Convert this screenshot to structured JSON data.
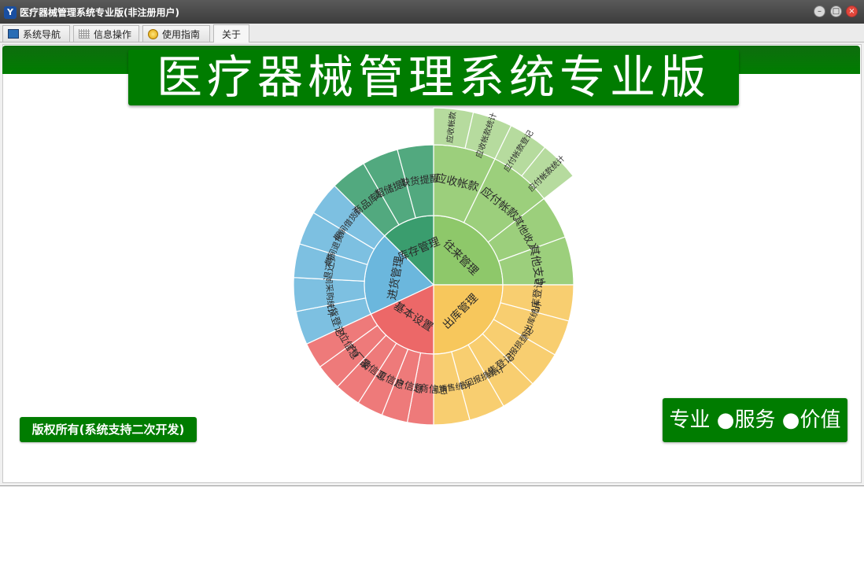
{
  "window": {
    "title": "医疗器械管理系统专业版(非注册用户)"
  },
  "tabs": [
    {
      "label": "系统导航",
      "icon": "monitor-icon"
    },
    {
      "label": "信息操作",
      "icon": "grid-icon"
    },
    {
      "label": "使用指南",
      "icon": "help-icon"
    },
    {
      "label": "关于",
      "icon": ""
    }
  ],
  "banner": {
    "title": "医疗器械管理系统专业版"
  },
  "copyright": "版权所有(系统支持二次开发)",
  "slogan": "专业 ●服务 ●价值",
  "colors": {
    "brand_green": "#007c00",
    "titlebar": "#3c3c3c"
  },
  "sunburst": {
    "groups": [
      {
        "name": "往来管理",
        "color": "#8ec86a",
        "children": [
          {
            "name": "应收帐款",
            "children": [
              "应收帐款",
              "应收帐款统计"
            ]
          },
          {
            "name": "应付帐款",
            "children": [
              "应付帐款登记",
              "应付帐款统计"
            ]
          },
          {
            "name": "其他收入",
            "children": []
          },
          {
            "name": "其他支出",
            "children": []
          }
        ]
      },
      {
        "name": "出库管理",
        "color": "#f7c75c",
        "children": [
          {
            "name": "出库登记",
            "children": []
          },
          {
            "name": "期间出库统计",
            "children": []
          },
          {
            "name": "退回报损登记",
            "children": []
          },
          {
            "name": "销售登记",
            "children": []
          },
          {
            "name": "期间退回报损统计",
            "children": []
          },
          {
            "name": "期间销售统计",
            "children": []
          }
        ]
      },
      {
        "name": "基本设置",
        "color": "#ec6868",
        "children": [
          {
            "name": "供货商信息",
            "children": []
          },
          {
            "name": "客户信息",
            "children": []
          },
          {
            "name": "员工信息",
            "children": []
          },
          {
            "name": "商品信息",
            "children": []
          },
          {
            "name": "生产厂家",
            "children": []
          },
          {
            "name": "本单位信息",
            "children": []
          }
        ]
      },
      {
        "name": "进货管理",
        "color": "#6bb7dd",
        "children": [
          {
            "name": "进货登记",
            "children": []
          },
          {
            "name": "期间采购统计",
            "children": []
          },
          {
            "name": "退还货",
            "children": []
          },
          {
            "name": "期间退货统计",
            "children": []
          },
          {
            "name": "期间借货查询",
            "children": []
          }
        ]
      },
      {
        "name": "库存管理",
        "color": "#3a9d6e",
        "children": [
          {
            "name": "商品库存",
            "children": []
          },
          {
            "name": "超储提醒",
            "children": []
          },
          {
            "name": "缺货提醒",
            "children": []
          }
        ]
      }
    ]
  }
}
